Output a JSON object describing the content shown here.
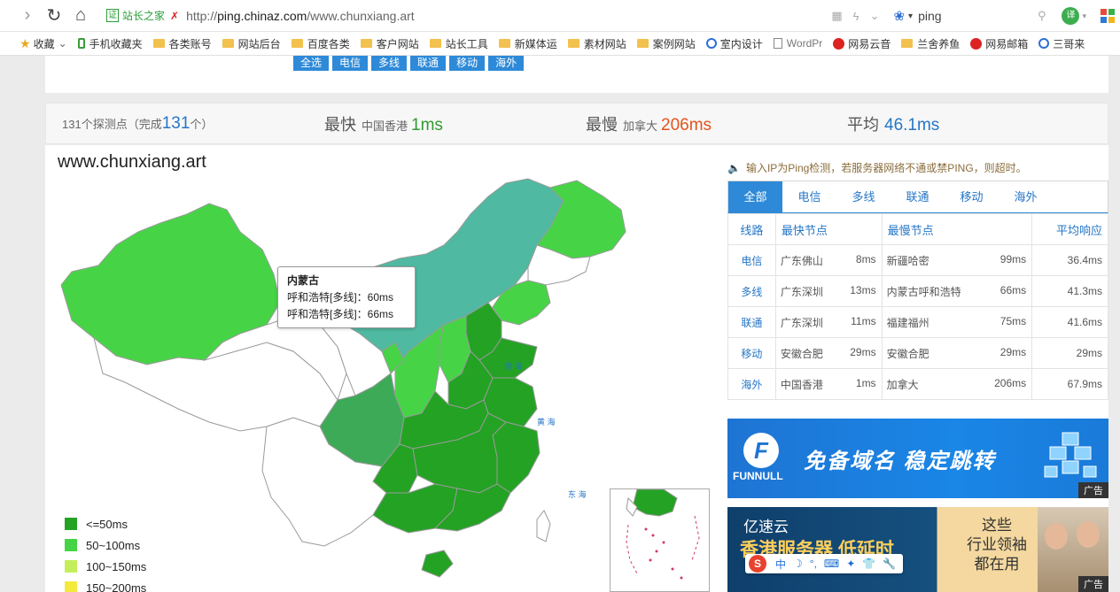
{
  "browser": {
    "site_badge": "站长之家",
    "url_prefix": "http://",
    "url_domain": "ping.chinaz.com",
    "url_path": "/www.chunxiang.art",
    "search_text": "ping",
    "translate_label": "译"
  },
  "bookmarks": [
    {
      "label": "收藏",
      "icon": "star-icon"
    },
    {
      "label": "手机收藏夹",
      "icon": "phone-icon"
    },
    {
      "label": "各类账号",
      "icon": "folder-icon"
    },
    {
      "label": "网站后台",
      "icon": "folder-icon"
    },
    {
      "label": "百度各类",
      "icon": "folder-icon"
    },
    {
      "label": "客户网站",
      "icon": "folder-icon"
    },
    {
      "label": "站长工具",
      "icon": "folder-icon"
    },
    {
      "label": "新媒体运",
      "icon": "folder-icon"
    },
    {
      "label": "素材网站",
      "icon": "folder-icon"
    },
    {
      "label": "案例网站",
      "icon": "folder-icon"
    },
    {
      "label": "室内设计",
      "icon": "shield-icon"
    },
    {
      "label": "WordPr",
      "icon": "doc-icon"
    },
    {
      "label": "网易云音",
      "icon": "netease-icon"
    },
    {
      "label": "兰舍养鱼",
      "icon": "folder-icon"
    },
    {
      "label": "网易邮箱",
      "icon": "mail-icon"
    },
    {
      "label": "三哥来",
      "icon": "shield-icon"
    }
  ],
  "filters": [
    "全选",
    "电信",
    "多线",
    "联通",
    "移动",
    "海外"
  ],
  "stats": {
    "nodes_prefix": "131个探测点（完成",
    "nodes_done": "131",
    "nodes_suffix": "个）",
    "fastest_label": "最快",
    "fastest_loc": "中国香港",
    "fastest_value": "1ms",
    "slowest_label": "最慢",
    "slowest_loc": "加拿大",
    "slowest_value": "206ms",
    "avg_label": "平均",
    "avg_value": "46.1ms"
  },
  "map": {
    "domain": "www.chunxiang.art",
    "tooltip": {
      "title": "内蒙古",
      "line1": "呼和浩特[多线]：60ms",
      "line2": "呼和浩特[多线]：66ms"
    },
    "legend": [
      {
        "label": "<=50ms",
        "color": "#24a224"
      },
      {
        "label": "50~100ms",
        "color": "#46d446"
      },
      {
        "label": "100~150ms",
        "color": "#c3ee5a"
      },
      {
        "label": "150~200ms",
        "color": "#f4ea3c"
      }
    ]
  },
  "notice": "输入IP为Ping检测，若服务器网络不通或禁PING，则超时。",
  "tabs": [
    "全部",
    "电信",
    "多线",
    "联通",
    "移动",
    "海外"
  ],
  "table": {
    "headers": [
      "线路",
      "最快节点",
      "最慢节点",
      "平均响应"
    ],
    "rows": [
      {
        "line": "电信",
        "fast_node": "广东佛山",
        "fast_ms": "8ms",
        "slow_node": "新疆哈密",
        "slow_ms": "99ms",
        "avg": "36.4ms"
      },
      {
        "line": "多线",
        "fast_node": "广东深圳",
        "fast_ms": "13ms",
        "slow_node": "内蒙古呼和浩特",
        "slow_ms": "66ms",
        "avg": "41.3ms"
      },
      {
        "line": "联通",
        "fast_node": "广东深圳",
        "fast_ms": "11ms",
        "slow_node": "福建福州",
        "slow_ms": "75ms",
        "avg": "41.6ms"
      },
      {
        "line": "移动",
        "fast_node": "安徽合肥",
        "fast_ms": "29ms",
        "slow_node": "安徽合肥",
        "slow_ms": "29ms",
        "avg": "29ms"
      },
      {
        "line": "海外",
        "fast_node": "中国香港",
        "fast_ms": "1ms",
        "slow_node": "加拿大",
        "slow_ms": "206ms",
        "avg": "67.9ms"
      }
    ]
  },
  "ads": {
    "ad1_brand": "FUNNULL",
    "ad1_slogan": "免备域名  稳定跳转",
    "ad_tag": "广告",
    "ad2_brand": "亿速云",
    "ad2_headline": "香港服务器 低延时",
    "ad2_side": "这些\n行业领袖\n都在用",
    "ad2_tag": "广告"
  }
}
